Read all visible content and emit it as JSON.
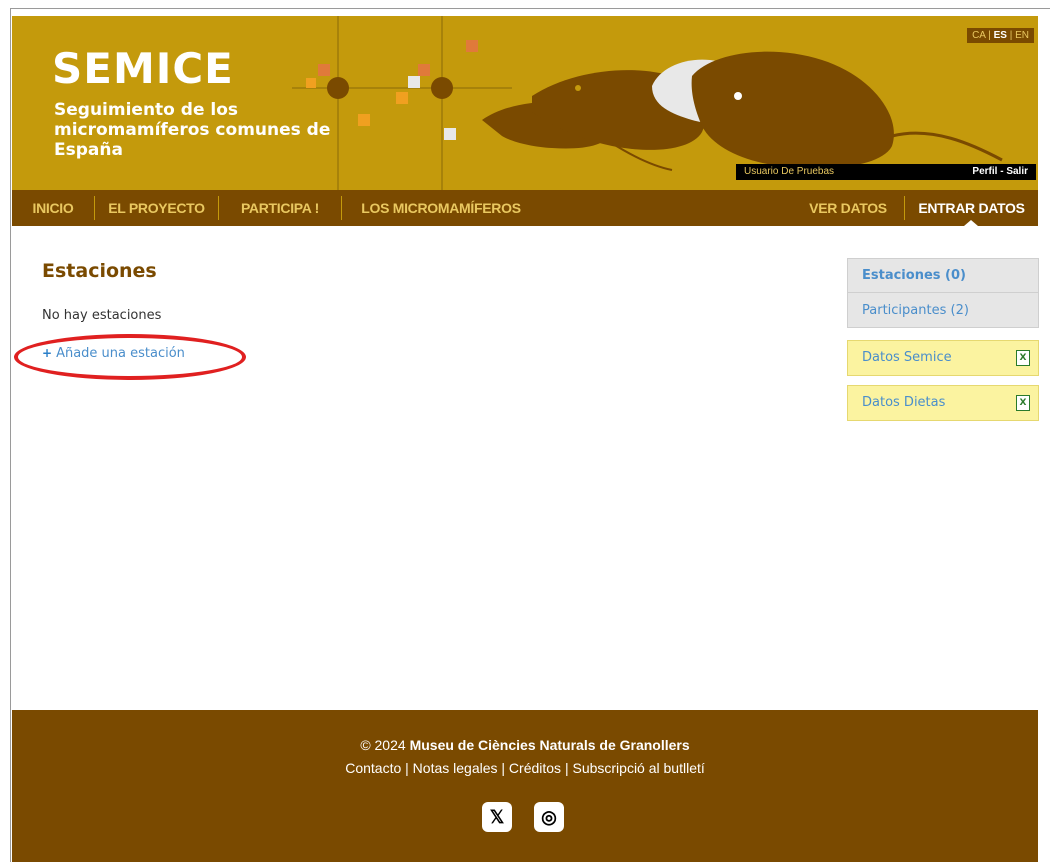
{
  "header": {
    "logo_title": "SEMICE",
    "logo_subtitle": "Seguimiento de los micromamíferos comunes de España",
    "lang": {
      "ca": "CA",
      "es": "ES",
      "en": "EN",
      "sep": "|"
    },
    "user_name": "Usuario De Pruebas",
    "user_links": "Perfil - Salir"
  },
  "nav": {
    "inicio": "INICIO",
    "proyecto": "EL PROYECTO",
    "participa": "PARTICIPA !",
    "micromamiferos": "LOS MICROMAMÍFEROS",
    "ver_datos": "VER DATOS",
    "entrar_datos": "ENTRAR DATOS"
  },
  "main": {
    "title": "Estaciones",
    "empty_text": "No hay estaciones",
    "add_plus": "+",
    "add_link": "Añade una estación"
  },
  "sidebar": {
    "estaciones": "Estaciones (0)",
    "participantes": "Participantes (2)",
    "datos_semice": "Datos Semice",
    "datos_dietas": "Datos Dietas",
    "excel_glyph": "X"
  },
  "footer": {
    "copy_prefix": "© 2024 ",
    "copy_org": "Museu de Ciències Naturals de Granollers",
    "links": "Contacto | Notas legales | Créditos | Subscripció al butlletí",
    "x_glyph": "𝕏",
    "ig_glyph": "◎"
  },
  "colors": {
    "header_gold": "#c49a0c",
    "nav_brown": "#7a4a00",
    "link_blue": "#4a8ecb",
    "highlight_red": "#e02020",
    "sidebar_yellow": "#fbf3a0"
  }
}
